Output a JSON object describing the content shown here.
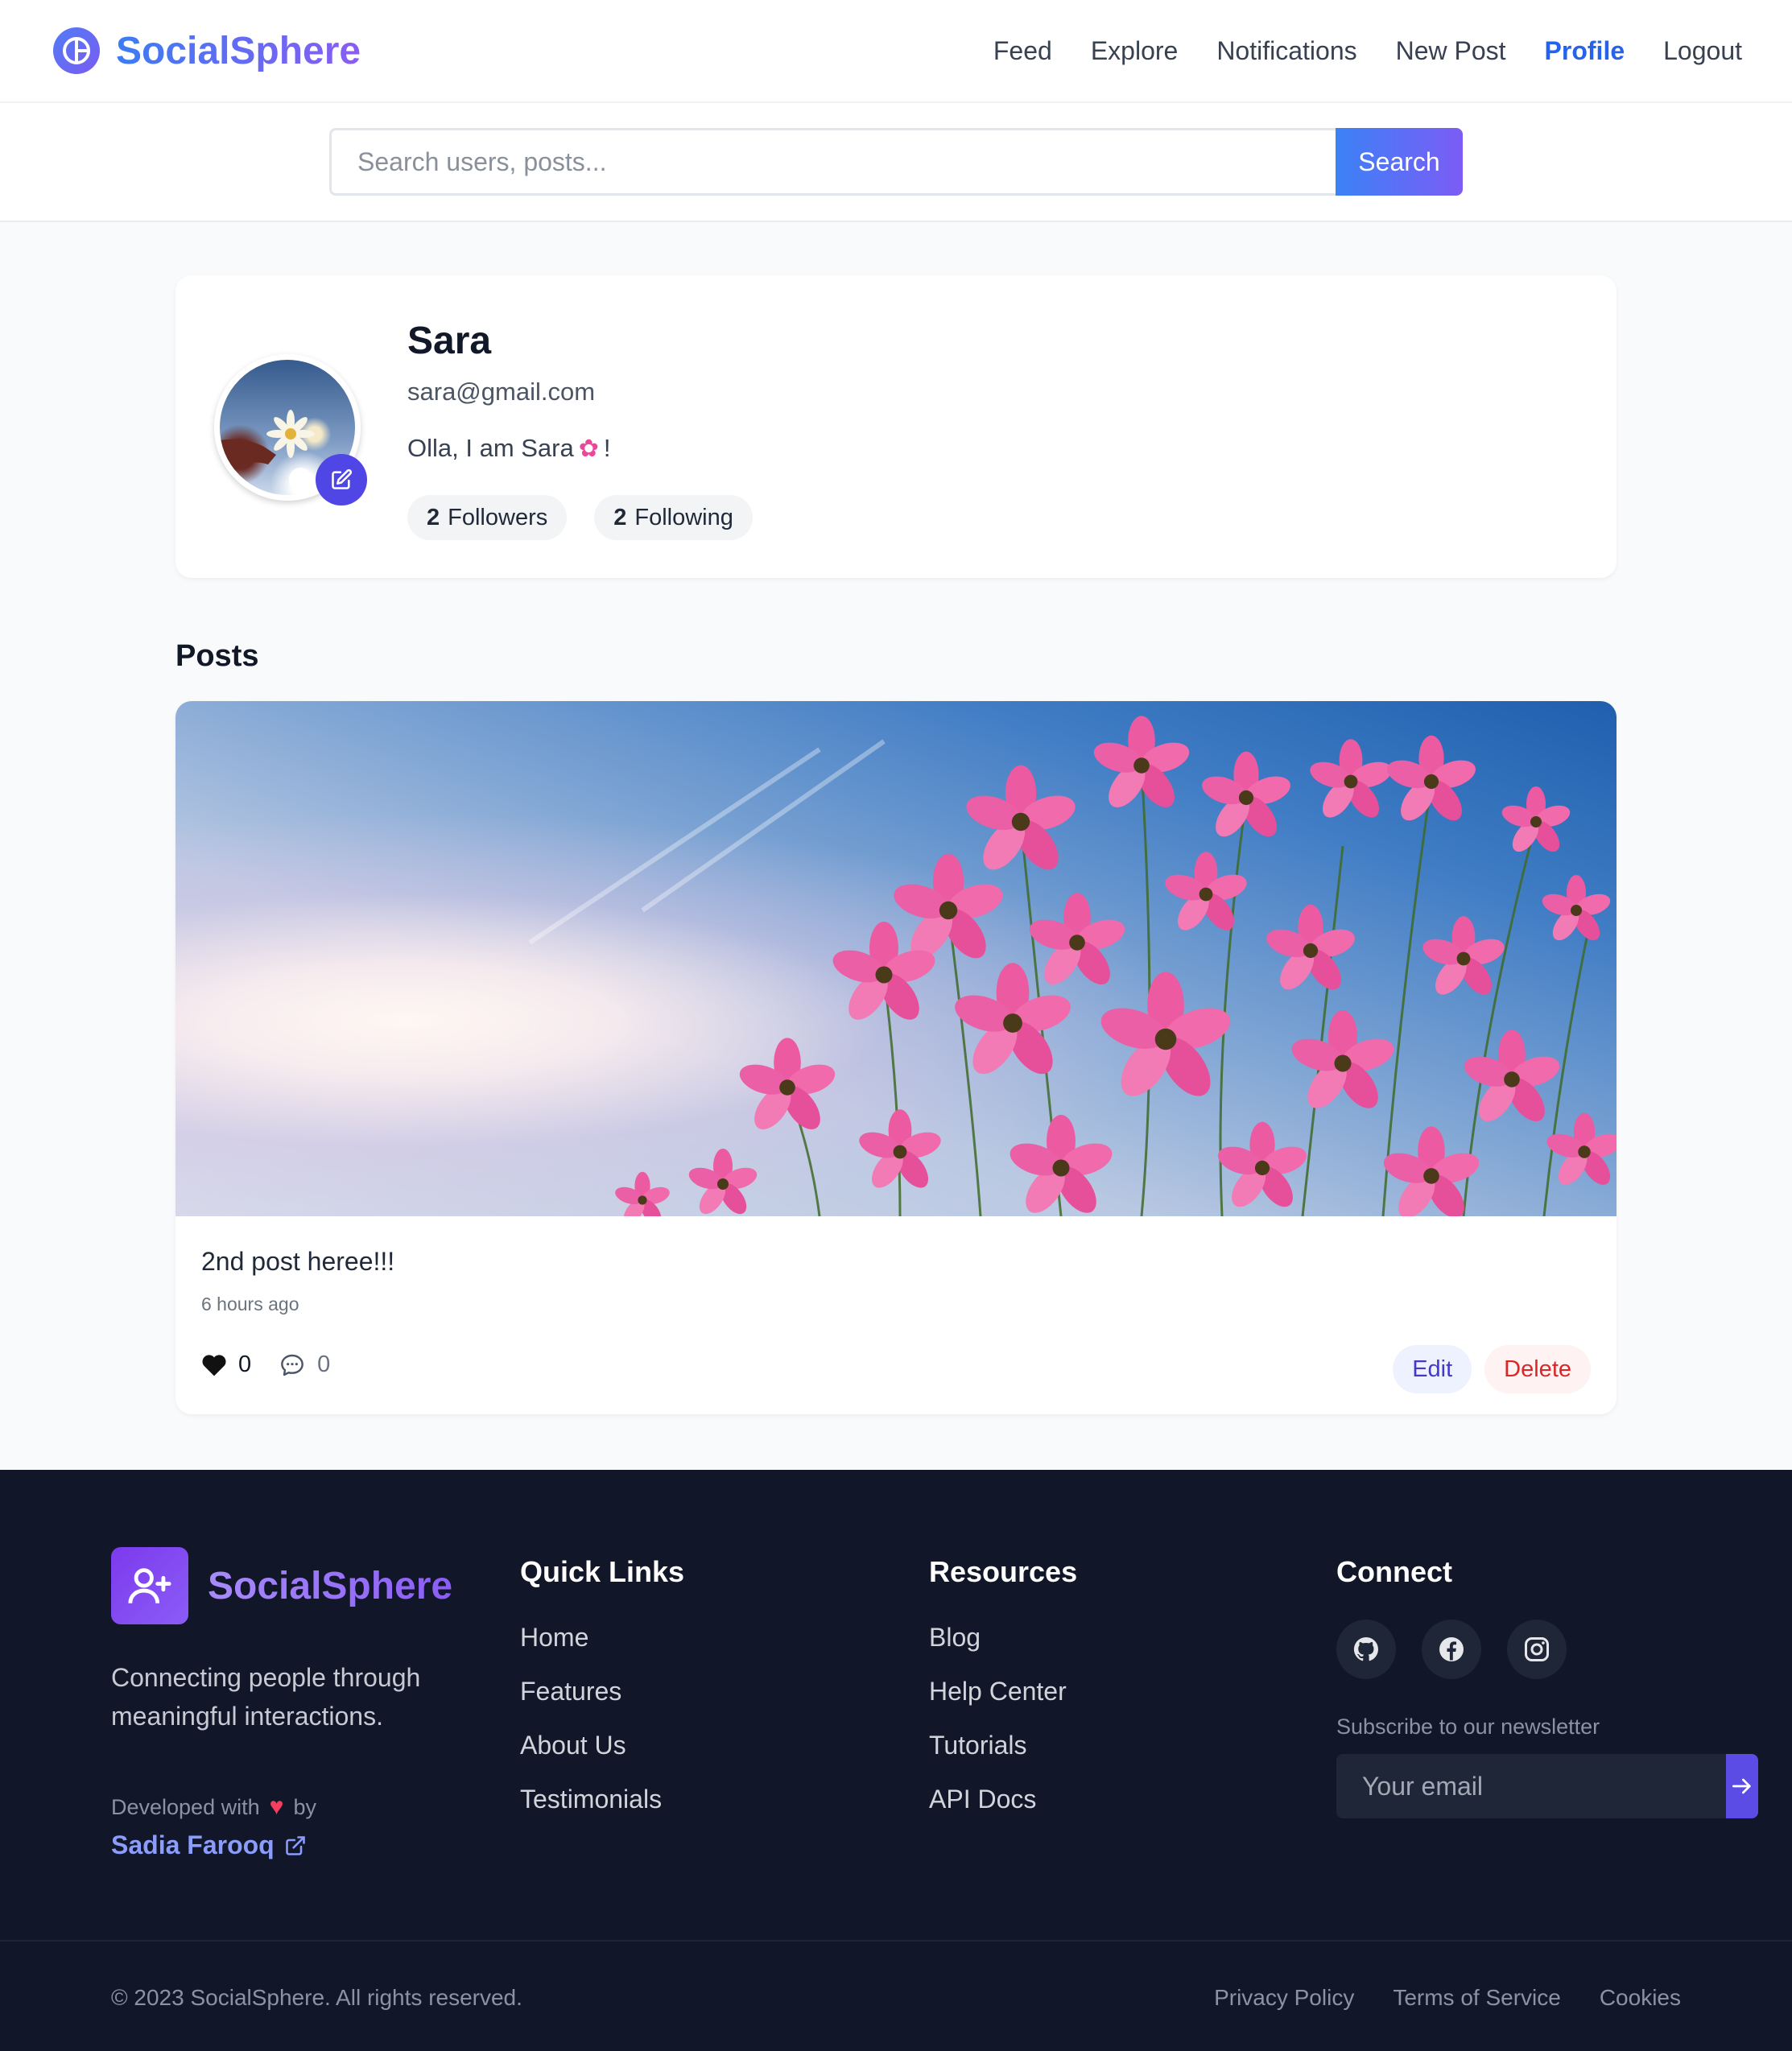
{
  "nav": {
    "brand": "SocialSphere",
    "links": [
      "Feed",
      "Explore",
      "Notifications",
      "New Post",
      "Profile",
      "Logout"
    ],
    "active": "Profile"
  },
  "search": {
    "placeholder": "Search users, posts...",
    "button": "Search"
  },
  "profile": {
    "name": "Sara",
    "email": "sara@gmail.com",
    "bio": "Olla, I am Sara",
    "bio_suffix": "!",
    "followers_count": "2",
    "followers_label": "Followers",
    "following_count": "2",
    "following_label": "Following"
  },
  "posts": {
    "heading": "Posts",
    "items": [
      {
        "caption": "2nd post heree!!!",
        "time": "6 hours ago",
        "likes": "0",
        "comments": "0",
        "edit_label": "Edit",
        "delete_label": "Delete"
      }
    ]
  },
  "footer": {
    "brand": "SocialSphere",
    "tagline": "Connecting people through meaningful interactions.",
    "dev_prefix": "Developed with",
    "dev_suffix": "by",
    "author": "Sadia Farooq",
    "quick_links": {
      "heading": "Quick Links",
      "items": [
        "Home",
        "Features",
        "About Us",
        "Testimonials"
      ]
    },
    "resources": {
      "heading": "Resources",
      "items": [
        "Blog",
        "Help Center",
        "Tutorials",
        "API Docs"
      ]
    },
    "connect": {
      "heading": "Connect",
      "socials": [
        "github-icon",
        "facebook-icon",
        "instagram-icon"
      ],
      "newsletter_label": "Subscribe to our newsletter",
      "email_placeholder": "Your email"
    },
    "copyright": "© 2023 SocialSphere. All rights reserved.",
    "legal": [
      "Privacy Policy",
      "Terms of Service",
      "Cookies"
    ]
  },
  "colors": {
    "accent": "#2563eb",
    "brand_gradient_start": "#3b82f6",
    "brand_gradient_end": "#7c5cf5",
    "footer_bg": "#111729",
    "delete": "#dc2626",
    "edit": "#4338ca"
  }
}
